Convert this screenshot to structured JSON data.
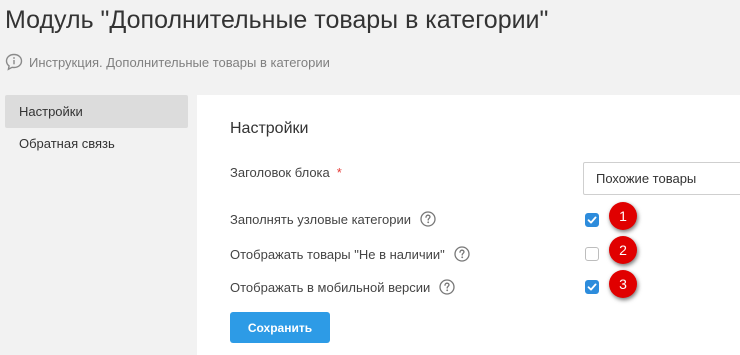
{
  "header": {
    "title": "Модуль \"Дополнительные товары в категории\"",
    "instruction_link": "Инструкция. Дополнительные товары в категории",
    "instruction_icon": "speech-bubble-info-icon"
  },
  "sidebar": {
    "items": [
      {
        "label": "Настройки",
        "active": true
      },
      {
        "label": "Обратная связь",
        "active": false
      }
    ]
  },
  "settings": {
    "title": "Настройки",
    "block_title": {
      "label": "Заголовок блока",
      "required_mark": "*",
      "value": "Похожие товары"
    },
    "fill_node_categories": {
      "label": "Заполнять узловые категории",
      "checked": true,
      "marker": "1"
    },
    "show_out_of_stock": {
      "label": "Отображать товары \"Не в наличии\"",
      "checked": false,
      "marker": "2"
    },
    "show_mobile": {
      "label": "Отображать в мобильной версии",
      "checked": true,
      "marker": "3"
    },
    "save_label": "Сохранить"
  },
  "colors": {
    "accent": "#2d9be6",
    "checkbox_checked": "#2d8cdc",
    "marker_red": "#e00000",
    "required_red": "#e53935"
  }
}
